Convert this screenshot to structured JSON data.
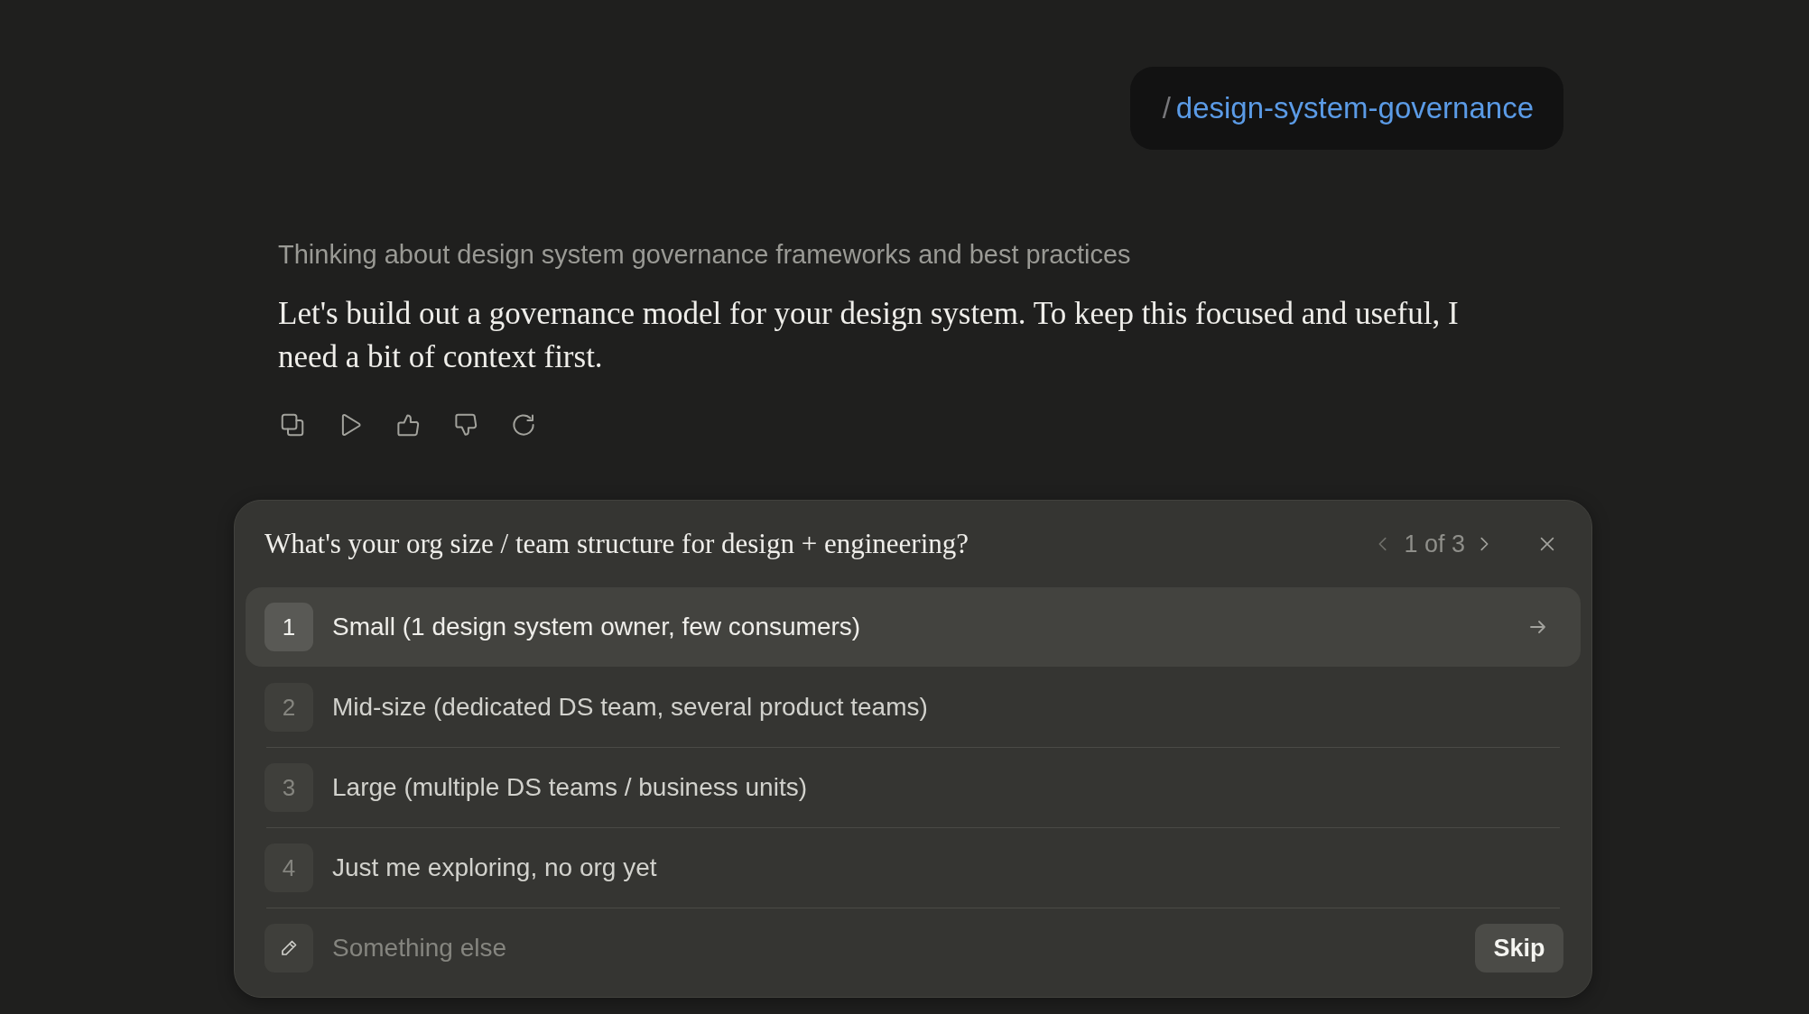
{
  "command_chip": {
    "prefix": "/",
    "command": "design-system-governance"
  },
  "thinking": "Thinking about design system governance frameworks and best practices",
  "message": "Let's build out a governance model for your design system. To keep this focused and useful, I need a bit of context first.",
  "question_card": {
    "question": "What's your org size / team structure for design + engineering?",
    "pager": "1 of 3",
    "options": [
      {
        "number": "1",
        "label": "Small (1 design system owner, few consumers)",
        "selected": true
      },
      {
        "number": "2",
        "label": "Mid-size (dedicated DS team, several product teams)",
        "selected": false
      },
      {
        "number": "3",
        "label": "Large (multiple DS teams / business units)",
        "selected": false
      },
      {
        "number": "4",
        "label": "Just me exploring, no org yet",
        "selected": false
      }
    ],
    "other": {
      "placeholder": "Something else"
    },
    "skip_button": "Skip"
  }
}
